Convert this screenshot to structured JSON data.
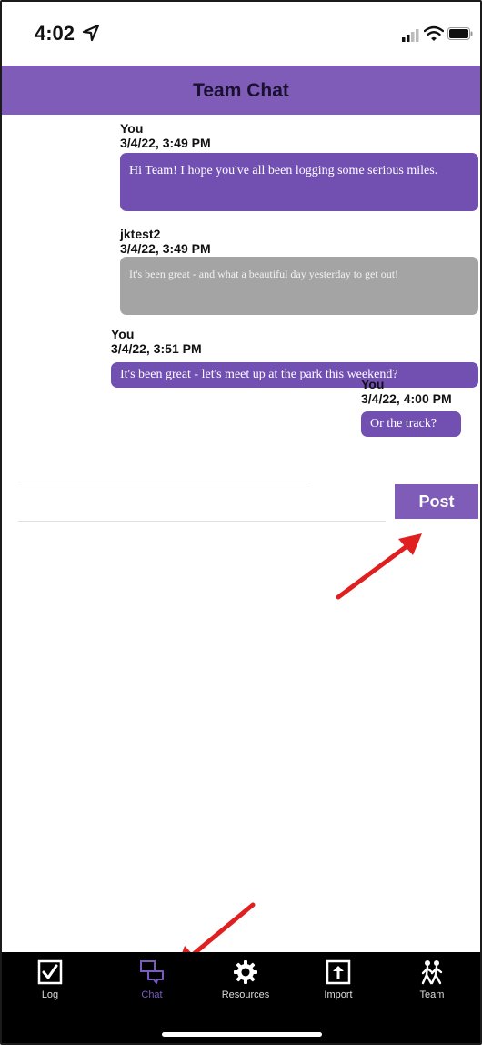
{
  "status_bar": {
    "time": "4:02"
  },
  "header": {
    "title": "Team Chat"
  },
  "messages": [
    {
      "sender": "You",
      "timestamp": "3/4/22, 3:49 PM",
      "text": "Hi Team!  I hope you've all been logging some serious miles."
    },
    {
      "sender": "jktest2",
      "timestamp": "3/4/22, 3:49 PM",
      "text": "It's been great - and what a beautiful day yesterday to get out!"
    },
    {
      "sender": "You",
      "timestamp": "3/4/22, 3:51 PM",
      "text": "It's been great - let's meet up at the park this weekend?"
    },
    {
      "sender": "You",
      "timestamp": "3/4/22, 4:00 PM",
      "text": "Or the track?"
    }
  ],
  "composer": {
    "value": "",
    "post_label": "Post"
  },
  "tabs": [
    {
      "label": "Log",
      "icon": "checkbox-icon"
    },
    {
      "label": "Chat",
      "icon": "chat-icon",
      "active": true
    },
    {
      "label": "Resources",
      "icon": "gear-icon"
    },
    {
      "label": "Import",
      "icon": "upload-icon"
    },
    {
      "label": "Team",
      "icon": "people-walking-icon"
    }
  ],
  "colors": {
    "accent": "#7e5cb8",
    "bubble_self": "#7250b2",
    "bubble_other": "#a4a4a4",
    "arrow": "#e02020"
  }
}
